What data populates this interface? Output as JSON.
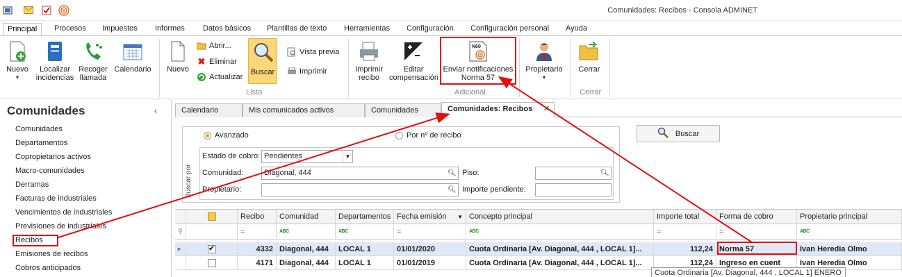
{
  "window": {
    "title": "Comunidades: Recibos - Consola ADMINET"
  },
  "menu": {
    "tabs": [
      "Principal",
      "Procesos",
      "Impuestos",
      "Informes",
      "Datos básicos",
      "Plantillas de texto",
      "Herramientas",
      "Configuración",
      "Configuración personal",
      "Ayuda"
    ]
  },
  "ribbon": {
    "nuevo1": "Nuevo",
    "localizar": "Localizar incidencias",
    "recoger": "Recoger llamada",
    "calendario": "Calendario",
    "nuevo2": "Nuevo",
    "abrir": "Abrir...",
    "eliminar": "Eliminar",
    "actualizar": "Actualizar",
    "buscar": "Buscar",
    "vista_previa": "Vista previa",
    "imprimir": "Imprimir",
    "group_lista": "Lista",
    "imprimir_recibo": "Imprimir recibo",
    "editar_comp": "Editar compensación",
    "enviar_notif": "Enviar notificaciones Norma 57",
    "group_adicional": "Adicional",
    "propietario": "Propietario",
    "cerrar": "Cerrar",
    "group_cerrar": "Cerrar",
    "norma_icon_text": "N60"
  },
  "left": {
    "title": "Comunidades",
    "collapse": "‹",
    "items": [
      "Comunidades",
      "Departamentos",
      "Copropietarios activos",
      "Macro-comunidades",
      "Derramas",
      "Facturas de industriales",
      "Vencimientos de industriales",
      "Previsiones de industriales",
      "Recibos",
      "Emisiones de recibos",
      "Cobros anticipados"
    ]
  },
  "doctabs": [
    "Calendario",
    "Mis comunicados activos",
    "Comunidades",
    "Comunidades: Recibos"
  ],
  "doctab_close": "✕",
  "search": {
    "side_label": "Buscar por",
    "mode_advanced": "Avanzado",
    "mode_number": "Por nº de recibo",
    "estado_label": "Estado de cobro:",
    "estado_value": "Pendientes",
    "comunidad_label": "Comunidad:",
    "comunidad_value": "Diagonal, 444",
    "piso_label": "Piso:",
    "piso_value": "",
    "propietario_label": "Propietario:",
    "propietario_value": "",
    "importe_label": "Importe pendiente:",
    "importe_value": "",
    "button": "Buscar"
  },
  "grid": {
    "columns": [
      "Recibo",
      "Comunidad",
      "Departamentos",
      "Fecha emisión",
      "Concepto principal",
      "Importe total",
      "Forma de cobro",
      "Propietario principal"
    ],
    "filter_eq": "=",
    "filter_abc": "ABC",
    "rows": [
      {
        "checked": true,
        "recibo": "4332",
        "comunidad": "Diagonal, 444",
        "depto": "LOCAL 1",
        "fecha": "01/01/2020",
        "concepto": "Cuota Ordinaria [Av. Diagonal, 444 , LOCAL 1]...",
        "importe": "112,24",
        "forma": "Norma 57",
        "propietario": "Ivan Heredia Olmo"
      },
      {
        "checked": false,
        "recibo": "4171",
        "comunidad": "Diagonal, 444",
        "depto": "LOCAL 1",
        "fecha": "01/01/2019",
        "concepto": "Cuota Ordinaria [Av. Diagonal, 444 , LOCAL 1]...",
        "importe": "112,24",
        "forma": "Ingreso en cuent",
        "propietario": "Ivan Heredia Olmo"
      }
    ]
  },
  "tooltip": "Cuota Ordinaria [Av. Diagonal, 444 , LOCAL 1] ENERO -",
  "colors": {
    "annotation": "#e01010",
    "selected_row": "#dfe8f6",
    "accent": "#f9d77a"
  }
}
